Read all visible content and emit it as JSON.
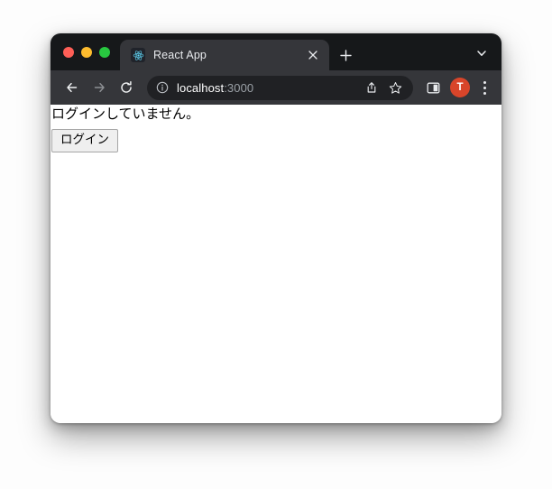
{
  "window": {
    "traffic_lights": [
      {
        "name": "close",
        "color": "#ff5f57"
      },
      {
        "name": "minimize",
        "color": "#febc2e"
      },
      {
        "name": "maximize",
        "color": "#28c840"
      }
    ]
  },
  "tabstrip": {
    "tabs": [
      {
        "title": "React App",
        "favicon": "react-logo-icon",
        "active": true,
        "close_label": "×"
      }
    ],
    "new_tab_label": "+",
    "tab_search_icon": "chevron-down-icon"
  },
  "toolbar": {
    "back_icon": "back-arrow-icon",
    "forward_icon": "forward-arrow-icon",
    "reload_icon": "reload-icon",
    "omnibox": {
      "site_info_icon": "info-circle-icon",
      "url_host": "localhost",
      "url_port": ":3000",
      "share_icon": "share-icon",
      "bookmark_icon": "star-icon"
    },
    "side_panel_icon": "side-panel-icon",
    "avatar_initial": "T",
    "avatar_color": "#d8452a",
    "menu_icon": "three-dot-menu-icon"
  },
  "page": {
    "status_text": "ログインしていません。",
    "login_button_label": "ログイン"
  }
}
